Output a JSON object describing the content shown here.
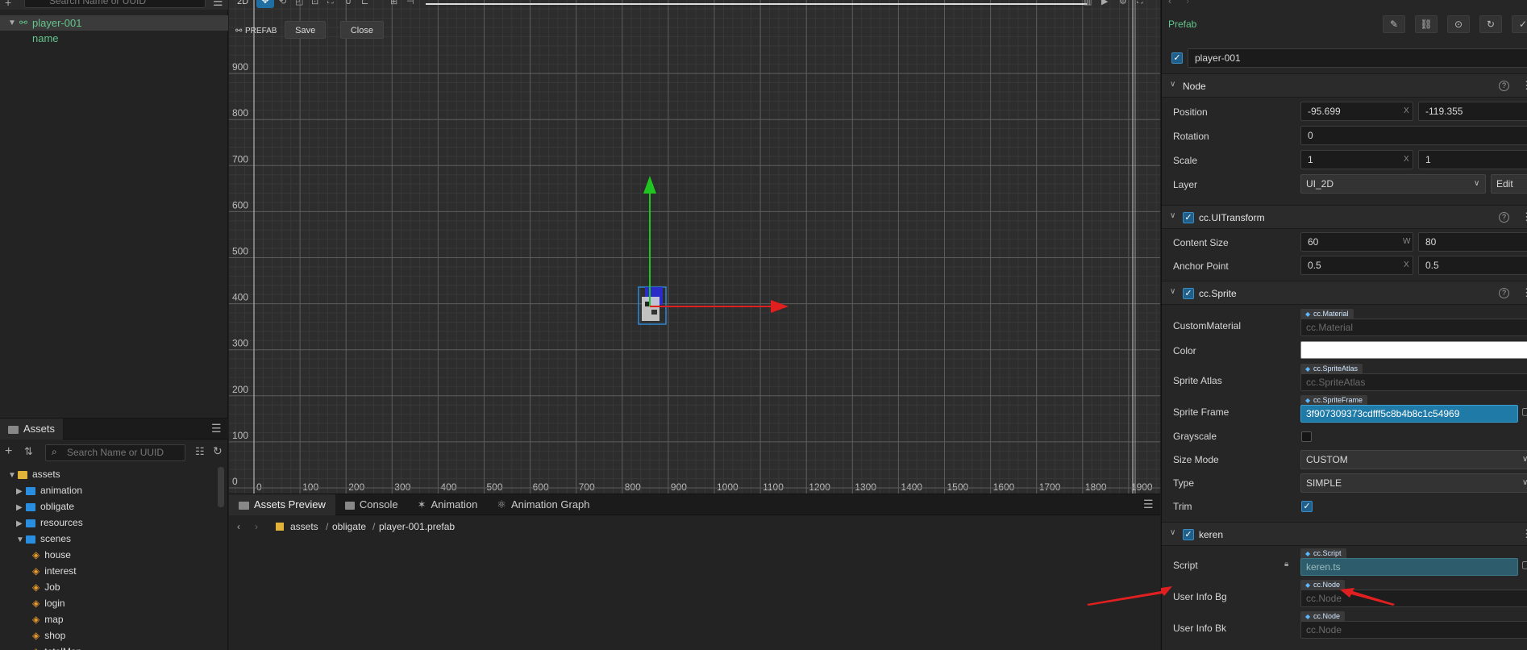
{
  "colors": {
    "accent_green": "#63c48c",
    "accent_blue": "#2a8ee0",
    "grid": "#5a5a5a",
    "axis_x": "#e01f1f",
    "axis_y": "#21c521",
    "annotation_arrow": "#e02020"
  },
  "hierarchy": {
    "search_placeholder": "Search Name or UUID",
    "items": [
      {
        "label": "player-001",
        "selected": true
      },
      {
        "label": "name",
        "selected": false
      }
    ]
  },
  "assets_panel": {
    "tab_label": "Assets",
    "search_placeholder": "Search Name or UUID",
    "tree": [
      {
        "label": "assets",
        "kind": "root",
        "depth": 0,
        "expanded": true
      },
      {
        "label": "animation",
        "kind": "folder",
        "depth": 1,
        "expanded": false
      },
      {
        "label": "obligate",
        "kind": "folder",
        "depth": 1,
        "expanded": false
      },
      {
        "label": "resources",
        "kind": "folder",
        "depth": 1,
        "expanded": false
      },
      {
        "label": "scenes",
        "kind": "folder",
        "depth": 1,
        "expanded": true
      },
      {
        "label": "house",
        "kind": "scene",
        "depth": 2
      },
      {
        "label": "interest",
        "kind": "scene",
        "depth": 2
      },
      {
        "label": "Job",
        "kind": "scene",
        "depth": 2
      },
      {
        "label": "login",
        "kind": "scene",
        "depth": 2
      },
      {
        "label": "map",
        "kind": "scene",
        "depth": 2
      },
      {
        "label": "shop",
        "kind": "scene",
        "depth": 2
      },
      {
        "label": "totalMap",
        "kind": "scene",
        "depth": 2
      }
    ]
  },
  "scene": {
    "mode_label": "2D",
    "prefab_label": "PREFAB",
    "save_label": "Save",
    "close_label": "Close",
    "y_ticks": [
      "900",
      "800",
      "700",
      "600",
      "500",
      "400",
      "300",
      "200",
      "100",
      "0"
    ],
    "x_ticks": [
      "0",
      "100",
      "200",
      "300",
      "400",
      "500",
      "600",
      "700",
      "800",
      "900",
      "1000",
      "1100",
      "1200",
      "1300",
      "1400",
      "1500",
      "1600",
      "1700",
      "1800",
      "1900"
    ]
  },
  "preview": {
    "tabs": [
      "Assets Preview",
      "Console",
      "Animation",
      "Animation Graph"
    ],
    "breadcrumb": [
      "assets",
      "obligate",
      "player-001.prefab"
    ]
  },
  "inspector": {
    "header_title": "Prefab",
    "node_name": "player-001",
    "sections": {
      "node": {
        "title": "Node",
        "position_label": "Position",
        "position_x": "-95.699",
        "position_y": "-119.355",
        "rotation_label": "Rotation",
        "rotation_value": "0",
        "scale_label": "Scale",
        "scale_x": "1",
        "scale_y": "1",
        "layer_label": "Layer",
        "layer_value": "UI_2D",
        "edit_label": "Edit"
      },
      "ui_transform": {
        "title": "cc.UITransform",
        "content_size_label": "Content Size",
        "width": "60",
        "height": "80",
        "anchor_label": "Anchor Point",
        "anchor_x": "0.5",
        "anchor_y": "0.5"
      },
      "sprite": {
        "title": "cc.Sprite",
        "custom_material_label": "CustomMaterial",
        "custom_material_tag": "cc.Material",
        "custom_material_value": "cc.Material",
        "color_label": "Color",
        "sprite_atlas_label": "Sprite Atlas",
        "sprite_atlas_tag": "cc.SpriteAtlas",
        "sprite_atlas_value": "cc.SpriteAtlas",
        "sprite_frame_label": "Sprite Frame",
        "sprite_frame_tag": "cc.SpriteFrame",
        "sprite_frame_value": "3f907309373cdfff5c8b4b8c1c54969",
        "grayscale_label": "Grayscale",
        "size_mode_label": "Size Mode",
        "size_mode_value": "CUSTOM",
        "type_label": "Type",
        "type_value": "SIMPLE",
        "trim_label": "Trim"
      },
      "keren": {
        "title": "keren",
        "script_label": "Script",
        "script_tag": "cc.Script",
        "script_value": "keren.ts",
        "user_info_bg_label": "User Info Bg",
        "user_info_bg_tag": "cc.Node",
        "user_info_bg_value": "cc.Node",
        "user_info_bk_label": "User Info Bk",
        "user_info_bk_tag": "cc.Node",
        "user_info_bk_value": "cc.Node"
      }
    }
  }
}
